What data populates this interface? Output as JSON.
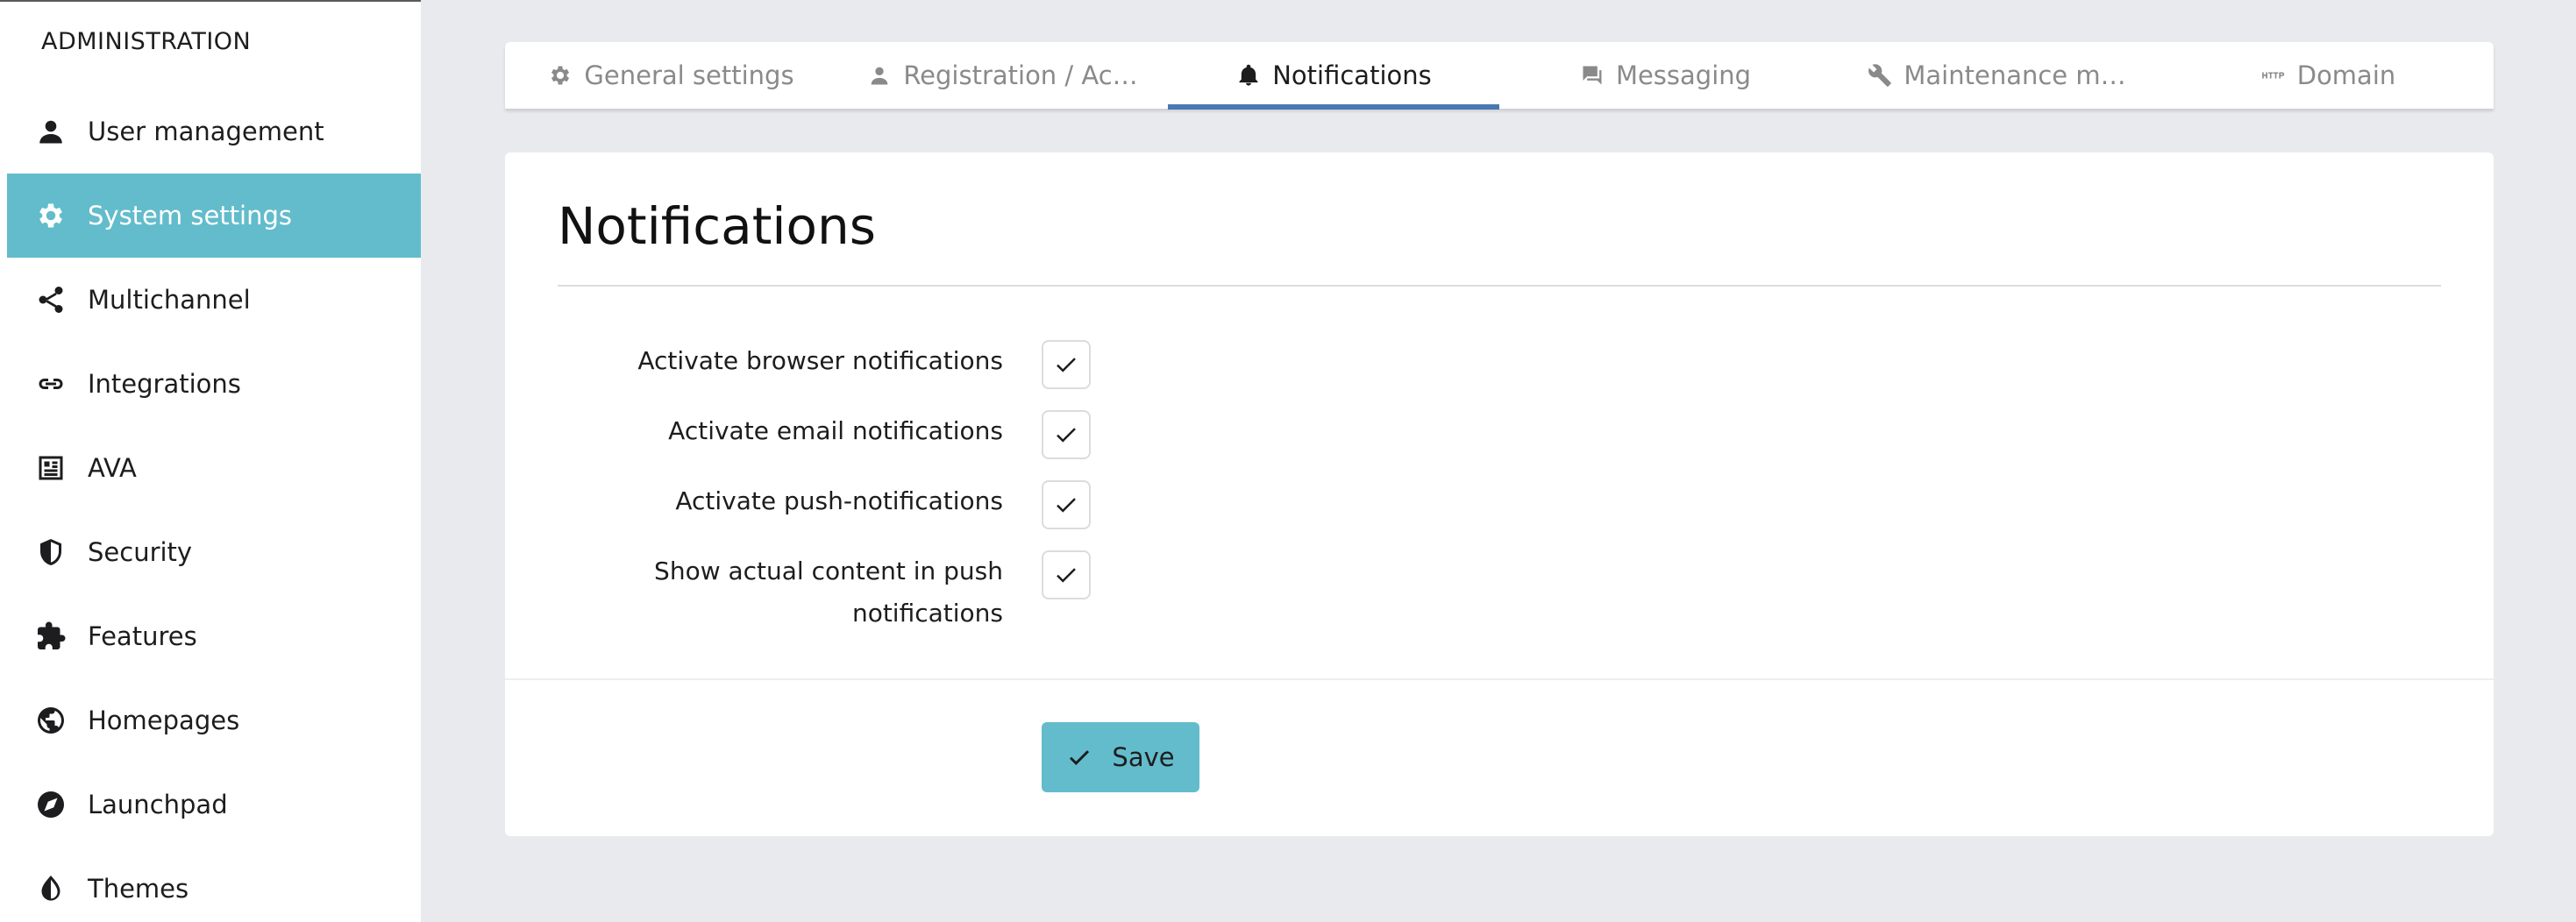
{
  "sidebar": {
    "heading": "ADMINISTRATION",
    "items": [
      {
        "label": "User management",
        "icon": "user-icon",
        "active": false
      },
      {
        "label": "System settings",
        "icon": "gear-icon",
        "active": true
      },
      {
        "label": "Multichannel",
        "icon": "share-icon",
        "active": false
      },
      {
        "label": "Integrations",
        "icon": "link-icon",
        "active": false
      },
      {
        "label": "AVA",
        "icon": "ava-icon",
        "active": false
      },
      {
        "label": "Security",
        "icon": "shield-icon",
        "active": false
      },
      {
        "label": "Features",
        "icon": "puzzle-icon",
        "active": false
      },
      {
        "label": "Homepages",
        "icon": "globe-icon",
        "active": false
      },
      {
        "label": "Launchpad",
        "icon": "compass-icon",
        "active": false
      },
      {
        "label": "Themes",
        "icon": "contrast-icon",
        "active": false
      }
    ]
  },
  "tabs": [
    {
      "label": "General settings",
      "icon": "gear-icon",
      "active": false
    },
    {
      "label": "Registration / Ac…",
      "icon": "person-icon",
      "active": false
    },
    {
      "label": "Notifications",
      "icon": "bell-icon",
      "active": true
    },
    {
      "label": "Messaging",
      "icon": "chat-icon",
      "active": false
    },
    {
      "label": "Maintenance m…",
      "icon": "wrench-icon",
      "active": false
    },
    {
      "label": "Domain",
      "icon": "http-icon",
      "active": false
    }
  ],
  "main": {
    "title": "Notifications",
    "settings": [
      {
        "label": "Activate browser notifications",
        "checked": true
      },
      {
        "label": "Activate email notifications",
        "checked": true
      },
      {
        "label": "Activate push-notifications",
        "checked": true
      },
      {
        "label": "Show actual content in push notifications",
        "checked": true
      }
    ],
    "save_label": "Save"
  },
  "colors": {
    "accent": "#63bccb",
    "tab_underline": "#4a78b3",
    "background": "#e9eaee"
  }
}
